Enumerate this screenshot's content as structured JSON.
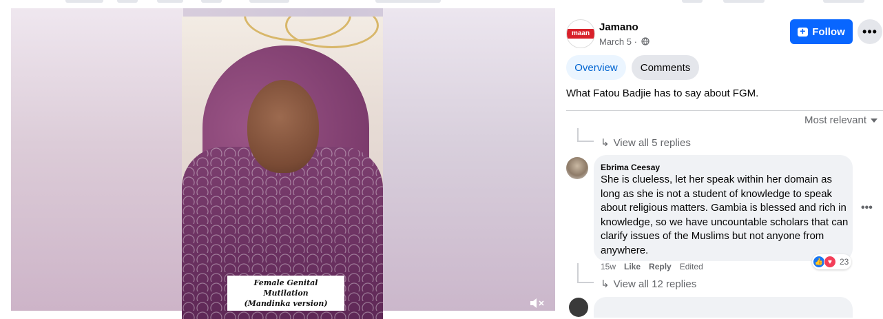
{
  "post": {
    "page_name": "Jamano",
    "logo_text": "maan",
    "date": "March 5 ·",
    "privacy_icon": "globe-icon",
    "text": "What Fatou Badjie has to say about FGM."
  },
  "header": {
    "follow_label": "Follow",
    "more_label": "•••"
  },
  "tabs": [
    {
      "label": "Overview",
      "active": true
    },
    {
      "label": "Comments",
      "active": false
    }
  ],
  "sort_label": "Most relevant",
  "video": {
    "caption_line1": "Female Genital Mutilation",
    "caption_line2": "(Mandinka version)",
    "mute_icon": "volume-muted-icon"
  },
  "replies": {
    "first": "View all 5 replies",
    "second": "View all 12 replies"
  },
  "comment": {
    "author": "Ebrima Ceesay",
    "text": "She is clueless, let her speak within her domain as long as she is not a student of knowledge to speak about religious matters. Gambia is blessed and rich in knowledge, so we have uncountable scholars that can clarify issues of the Muslims but not anyone from anywhere.",
    "time": "15w",
    "like": "Like",
    "reply": "Reply",
    "edited": "Edited",
    "reaction_count": "23",
    "more": "•••"
  },
  "colors": {
    "accent": "#0866ff",
    "tab_active_bg": "#ebf5ff",
    "tab_active_text": "#0064d1",
    "secondary_text": "#65676b",
    "bubble_bg": "#f0f2f5",
    "logo_red": "#d8202a"
  }
}
